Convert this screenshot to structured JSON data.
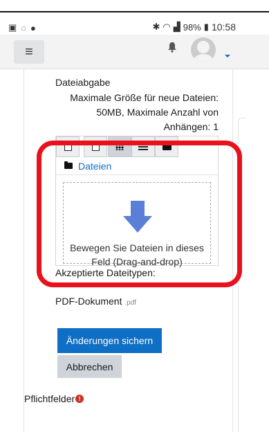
{
  "status_bar": {
    "left_icons": [
      "image-icon",
      "wind-icon",
      "circle-icon"
    ],
    "right_icons": [
      "bluetooth-icon",
      "wifi-icon",
      "signal-icon"
    ],
    "battery": "98%",
    "time": "10:58"
  },
  "navbar": {
    "menu_glyph": "≡",
    "bell_glyph": "🔔"
  },
  "form": {
    "field_label": "Dateiabgabe",
    "info_lines": [
      "Maximale Größe für neue Dateien:",
      "50MB, Maximale Anzahl von",
      "Anhängen: 1"
    ],
    "path_label": "Dateien",
    "dropzone_text": "Bewegen Sie Dateien in dieses Feld (Drag-and-drop)",
    "accepted_label": "Akzeptierte Dateitypen:",
    "pdf_label": "PDF-Dokument",
    "pdf_ext": ".pdf",
    "save_label": "Änderungen sichern",
    "cancel_label": "Abbrechen",
    "required_label": "Pflichtfelder",
    "required_glyph": "!"
  },
  "colors": {
    "accent": "#0f6fc5",
    "highlight": "#e8111c",
    "arrow": "#5b7fd6",
    "required": "#ca3120"
  }
}
